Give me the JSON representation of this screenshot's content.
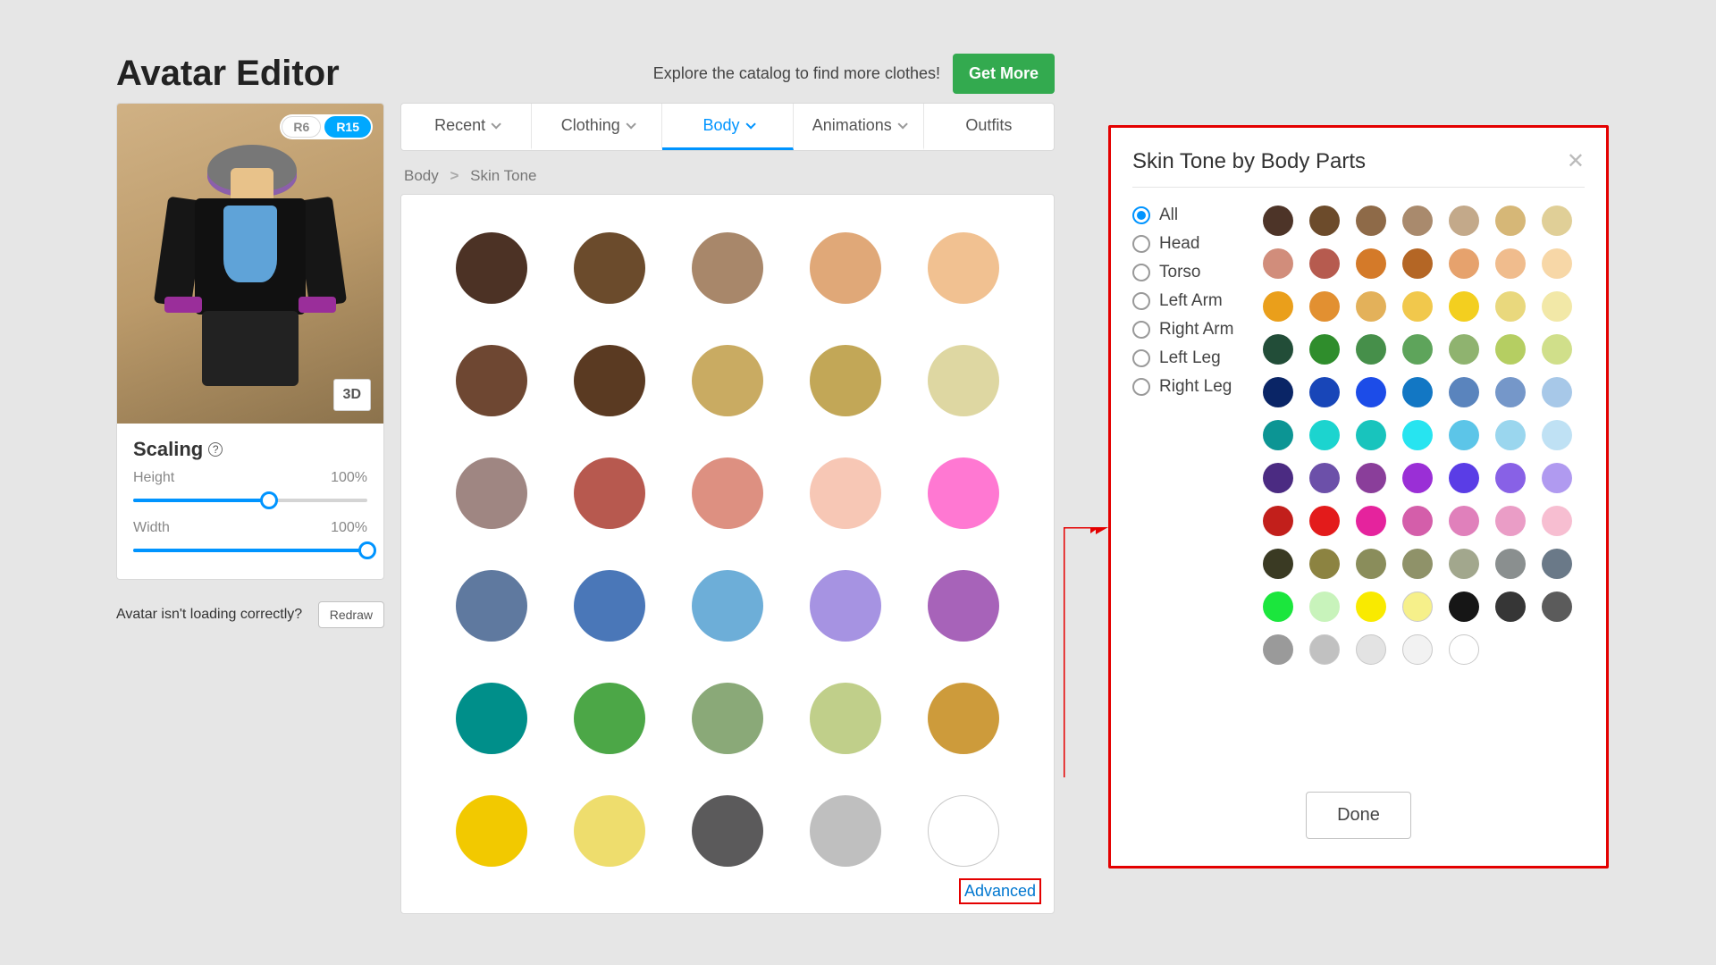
{
  "header": {
    "title": "Avatar Editor",
    "catalog_text": "Explore the catalog to find more clothes!",
    "get_more_label": "Get More"
  },
  "avatar_preview": {
    "mode_r6": "R6",
    "mode_r15": "R15",
    "three_d_label": "3D"
  },
  "scaling": {
    "title": "Scaling",
    "help": "?",
    "height_label": "Height",
    "height_value": "100%",
    "height_pct": 58,
    "width_label": "Width",
    "width_value": "100%",
    "width_pct": 100
  },
  "not_loading_text": "Avatar isn't loading correctly?",
  "redraw_label": "Redraw",
  "tabs": {
    "recent": "Recent",
    "clothing": "Clothing",
    "body": "Body",
    "animations": "Animations",
    "outfits": "Outfits"
  },
  "breadcrumb": {
    "root": "Body",
    "leaf": "Skin Tone",
    "sep": ">"
  },
  "main_swatches": [
    "#4c3225",
    "#6b4b2c",
    "#a8876a",
    "#e0a878",
    "#f1c191",
    "#6e4732",
    "#5a3a22",
    "#c9ab62",
    "#c2a757",
    "#ded7a2",
    "#9f8682",
    "#b7594f",
    "#dd9081",
    "#f7c7b5",
    "#ff78d2",
    "#5f799f",
    "#4a77b8",
    "#6daed8",
    "#a693e2",
    "#a763b9",
    "#008f8a",
    "#4ca747",
    "#8aa978",
    "#c0cf8a",
    "#cd9b3b",
    "#f2c900",
    "#eedd6d",
    "#5b5a5b",
    "#bfbfbf",
    "#ffffff"
  ],
  "advanced_label": "Advanced",
  "modal": {
    "title": "Skin Tone by Body Parts",
    "body_parts": [
      "All",
      "Head",
      "Torso",
      "Left Arm",
      "Right Arm",
      "Left Leg",
      "Right Leg"
    ],
    "selected_index": 0,
    "done_label": "Done",
    "swatches": [
      "#4d3428",
      "#6c4b2b",
      "#8e6a48",
      "#a98a6d",
      "#c3a98a",
      "#d6b777",
      "#e0cf97",
      "#d18d7b",
      "#b65b4f",
      "#d47a29",
      "#b46625",
      "#e6a26d",
      "#f0bc8d",
      "#f7d7a7",
      "#ea9f1b",
      "#e29031",
      "#e3b15a",
      "#f1c84c",
      "#f3cf1f",
      "#e9d87d",
      "#f2e8a7",
      "#224d38",
      "#2f8d2c",
      "#468f4a",
      "#5ea45b",
      "#8fb36f",
      "#b5ce62",
      "#d0df8a",
      "#0a2566",
      "#1846b8",
      "#1c4ce8",
      "#1277c4",
      "#5a84bd",
      "#7597c9",
      "#a7c8e8",
      "#0c9594",
      "#1cd4cf",
      "#18c4bd",
      "#27e4f0",
      "#5cc5e8",
      "#9ad6ee",
      "#bfe1f4",
      "#4b2b82",
      "#6c50a9",
      "#8a3e9a",
      "#9a2fd6",
      "#5a3de6",
      "#8861e6",
      "#b09af0",
      "#c21f1b",
      "#e31b1b",
      "#e5239d",
      "#d45eaa",
      "#e080bb",
      "#ea9dc6",
      "#f7bed1",
      "#3a3a23",
      "#8c8341",
      "#8a8d5b",
      "#8f9269",
      "#a2a78d",
      "#8a8f8f",
      "#6a7988",
      "#1be63d",
      "#c8f3bb",
      "#f9ea00",
      "#f6f08a_out",
      "#161616",
      "#363636",
      "#5b5b5b",
      "#9a9a9a",
      "#c1c1c1_out",
      "#e3e3e3_out",
      "#f2f2f2_out",
      "#ffffff_out"
    ]
  }
}
